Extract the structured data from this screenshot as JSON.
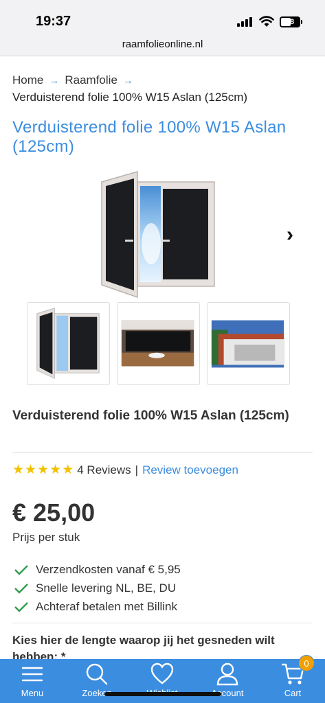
{
  "status_bar": {
    "time": "19:37",
    "battery": "38"
  },
  "browser": {
    "url": "raamfolieonline.nl"
  },
  "breadcrumb": {
    "items": [
      "Home",
      "Raamfolie"
    ],
    "current": "Verduisterend folie 100% W15 Aslan (125cm)"
  },
  "product": {
    "title": "Verduisterend folie 100% W15 Aslan (125cm)",
    "name": "Verduisterend folie 100% W15 Aslan (125cm)",
    "rating": 5,
    "rating_max": 5,
    "reviews_text": "4 Reviews",
    "review_separator": "|",
    "add_review_label": "Review toevoegen",
    "price": "€ 25,00",
    "price_note": "Prijs per stuk",
    "usps": [
      "Verzendkosten vanaf € 5,95",
      "Snelle levering NL, BE, DU",
      "Achteraf betalen met Billink"
    ],
    "length_label": "Kies hier de lengte waarop jij het gesneden wilt hebben: *"
  },
  "gallery": {
    "thumbnails": [
      "window-film-thumb",
      "interior-room-thumb",
      "building-exterior-thumb"
    ]
  },
  "bottom_nav": {
    "items": [
      {
        "label": "Menu",
        "icon": "menu-icon"
      },
      {
        "label": "Zoeken",
        "icon": "search-icon"
      },
      {
        "label": "Wishlist",
        "icon": "heart-icon"
      },
      {
        "label": "Account",
        "icon": "user-icon"
      },
      {
        "label": "Cart",
        "icon": "cart-icon"
      }
    ],
    "cart_count": "0"
  },
  "colors": {
    "accent": "#3b8de0",
    "star": "#f2c200",
    "check": "#2e9e4f",
    "badge": "#f0a000"
  }
}
